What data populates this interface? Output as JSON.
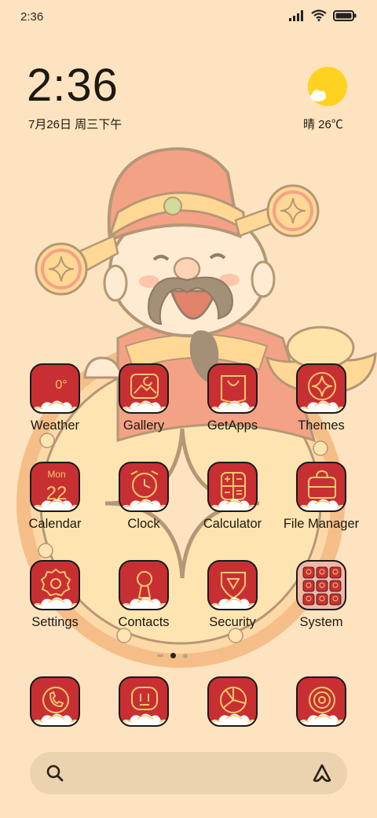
{
  "status_bar": {
    "time": "2:36",
    "icons": [
      "signal-icon",
      "wifi-icon",
      "battery-icon"
    ]
  },
  "clock_widget": {
    "time": "2:36",
    "date": "7月26日 周三下午"
  },
  "weather_widget": {
    "icon": "sun-cloud-icon",
    "text": "晴 26℃"
  },
  "apps": [
    {
      "label": "Weather",
      "icon": "weather-icon",
      "tile_text": "0°"
    },
    {
      "label": "Gallery",
      "icon": "gallery-icon"
    },
    {
      "label": "GetApps",
      "icon": "getapps-icon"
    },
    {
      "label": "Themes",
      "icon": "themes-icon"
    },
    {
      "label": "Calendar",
      "icon": "calendar-icon",
      "tile_text": "Mon",
      "tile_number": "22"
    },
    {
      "label": "Clock",
      "icon": "clock-icon"
    },
    {
      "label": "Calculator",
      "icon": "calculator-icon"
    },
    {
      "label": "File Manager",
      "icon": "file-manager-icon"
    },
    {
      "label": "Settings",
      "icon": "settings-icon"
    },
    {
      "label": "Contacts",
      "icon": "contacts-icon"
    },
    {
      "label": "Security",
      "icon": "security-icon"
    },
    {
      "label": "System",
      "icon": "system-folder-icon"
    }
  ],
  "page_indicator": {
    "pages": 3,
    "current": 2
  },
  "dock": [
    {
      "icon": "phone-icon"
    },
    {
      "icon": "messages-icon"
    },
    {
      "icon": "browser-icon"
    },
    {
      "icon": "camera-icon"
    }
  ],
  "search_bar": {
    "left_icon": "search-icon",
    "right_icon": "assistant-icon"
  },
  "colors": {
    "background": "#fde3bf",
    "tile": "#c82f33",
    "line_gold": "#f3c76a",
    "sun": "#ffd21f"
  }
}
